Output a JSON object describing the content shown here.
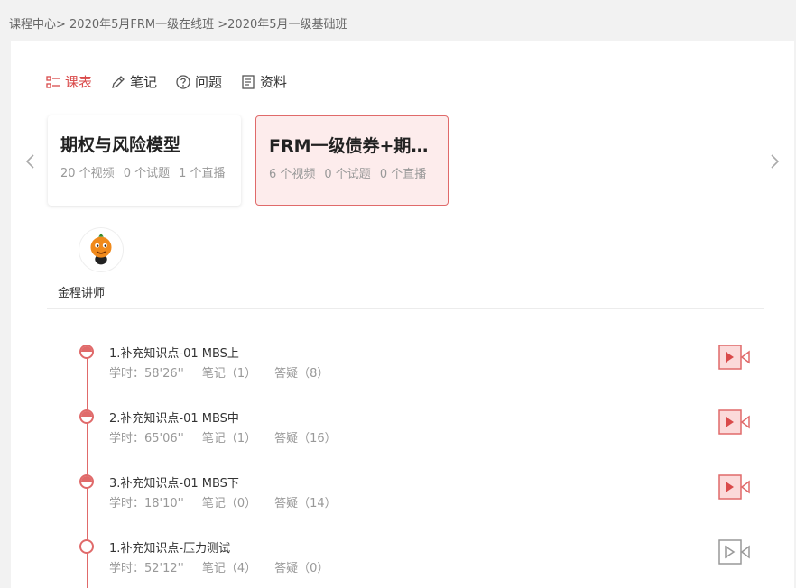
{
  "breadcrumb": {
    "part1": "课程中心>",
    "part2": " 2020年5月FRM一级在线班",
    "part3": " >2020年5月一级基础班"
  },
  "tabs": [
    {
      "label": "课表",
      "icon": "list-icon",
      "active": true
    },
    {
      "label": "笔记",
      "icon": "pencil-icon",
      "active": false
    },
    {
      "label": "问题",
      "icon": "question-icon",
      "active": false
    },
    {
      "label": "资料",
      "icon": "document-icon",
      "active": false
    }
  ],
  "cards": [
    {
      "title": "期权与风险模型",
      "videos": "20 个视频",
      "tests": "0 个试题",
      "lives": "1 个直播",
      "selected": false
    },
    {
      "title": "FRM一级债券+期…",
      "videos": "6 个视频",
      "tests": "0 个试题",
      "lives": "0 个直播",
      "selected": true
    }
  ],
  "teacher": {
    "name": "金程讲师",
    "avatar_icon": "orange-mascot-avatar"
  },
  "lessons": [
    {
      "title": "1.补充知识点-01 MBS上",
      "hours": "学时：58'26''",
      "notes": "笔记（1）",
      "questions": "答疑（8）",
      "status": "done"
    },
    {
      "title": "2.补充知识点-01 MBS中",
      "hours": "学时：65'06''",
      "notes": "笔记（1）",
      "questions": "答疑（16）",
      "status": "done"
    },
    {
      "title": "3.补充知识点-01 MBS下",
      "hours": "学时：18'10''",
      "notes": "笔记（0）",
      "questions": "答疑（14）",
      "status": "done"
    },
    {
      "title": "1.补充知识点-压力测试",
      "hours": "学时：52'12''",
      "notes": "笔记（4）",
      "questions": "答疑（0）",
      "status": "todo"
    }
  ],
  "colors": {
    "accent": "#e06a6a",
    "accent_bg": "#fdecec",
    "gray_icon": "#999999"
  }
}
